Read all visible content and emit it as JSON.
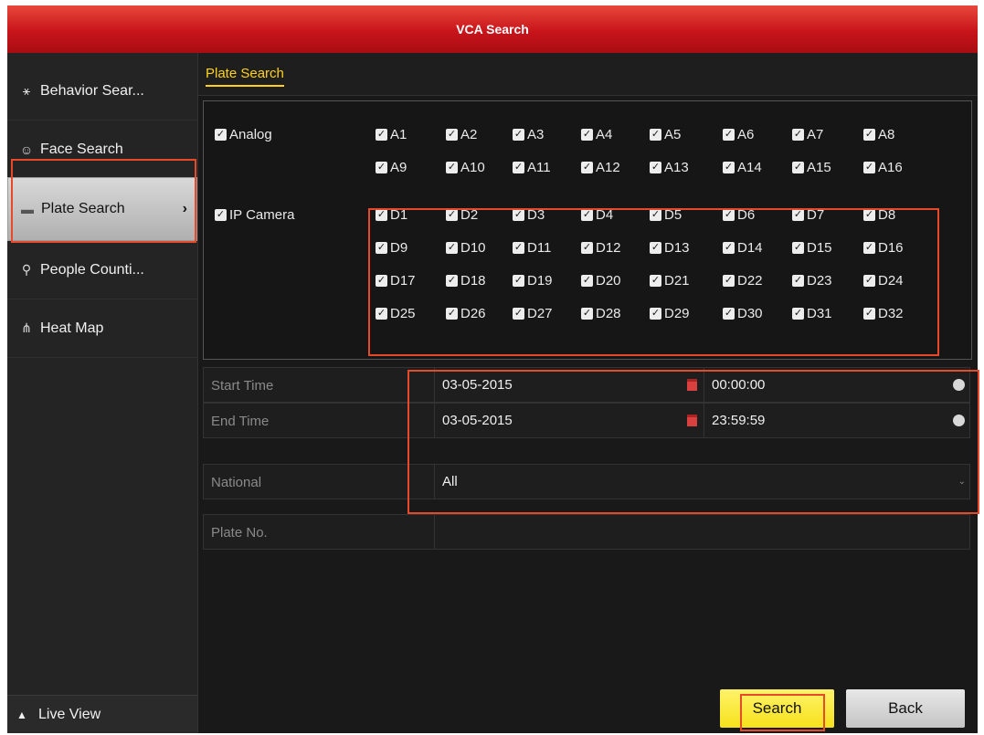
{
  "window": {
    "title": "VCA Search"
  },
  "sidebar": {
    "items": [
      {
        "label": "Behavior Sear...",
        "icon": "running-person-icon",
        "glyph": "⚹"
      },
      {
        "label": "Face Search",
        "icon": "face-icon",
        "glyph": "☺"
      },
      {
        "label": "Plate Search",
        "icon": "car-icon",
        "glyph": "▬",
        "active": true
      },
      {
        "label": "People Counti...",
        "icon": "people-icon",
        "glyph": "⚲"
      },
      {
        "label": "Heat Map",
        "icon": "heat-map-icon",
        "glyph": "⋔"
      }
    ],
    "live_view": {
      "label": "Live View",
      "icon": "home-icon",
      "glyph": "▲"
    }
  },
  "tabs": [
    {
      "label": "Plate Search",
      "active": true
    }
  ],
  "channels": {
    "analog": {
      "label": "Analog",
      "checked": true,
      "items": [
        "A1",
        "A2",
        "A3",
        "A4",
        "A5",
        "A6",
        "A7",
        "A8",
        "A9",
        "A10",
        "A11",
        "A12",
        "A13",
        "A14",
        "A15",
        "A16"
      ]
    },
    "ip_camera": {
      "label": "IP Camera",
      "checked": true,
      "items": [
        "D1",
        "D2",
        "D3",
        "D4",
        "D5",
        "D6",
        "D7",
        "D8",
        "D9",
        "D10",
        "D11",
        "D12",
        "D13",
        "D14",
        "D15",
        "D16",
        "D17",
        "D18",
        "D19",
        "D20",
        "D21",
        "D22",
        "D23",
        "D24",
        "D25",
        "D26",
        "D27",
        "D28",
        "D29",
        "D30",
        "D31",
        "D32"
      ]
    }
  },
  "form": {
    "start_time": {
      "label": "Start Time",
      "date": "03-05-2015",
      "time": "00:00:00"
    },
    "end_time": {
      "label": "End Time",
      "date": "03-05-2015",
      "time": "23:59:59"
    },
    "national": {
      "label": "National",
      "value": "All"
    },
    "plate_no": {
      "label": "Plate No.",
      "value": ""
    }
  },
  "buttons": {
    "search": "Search",
    "back": "Back"
  },
  "colors": {
    "title_red": "#c8141b",
    "accent_yellow": "#ffd21a",
    "annotation": "#e74a2a"
  }
}
